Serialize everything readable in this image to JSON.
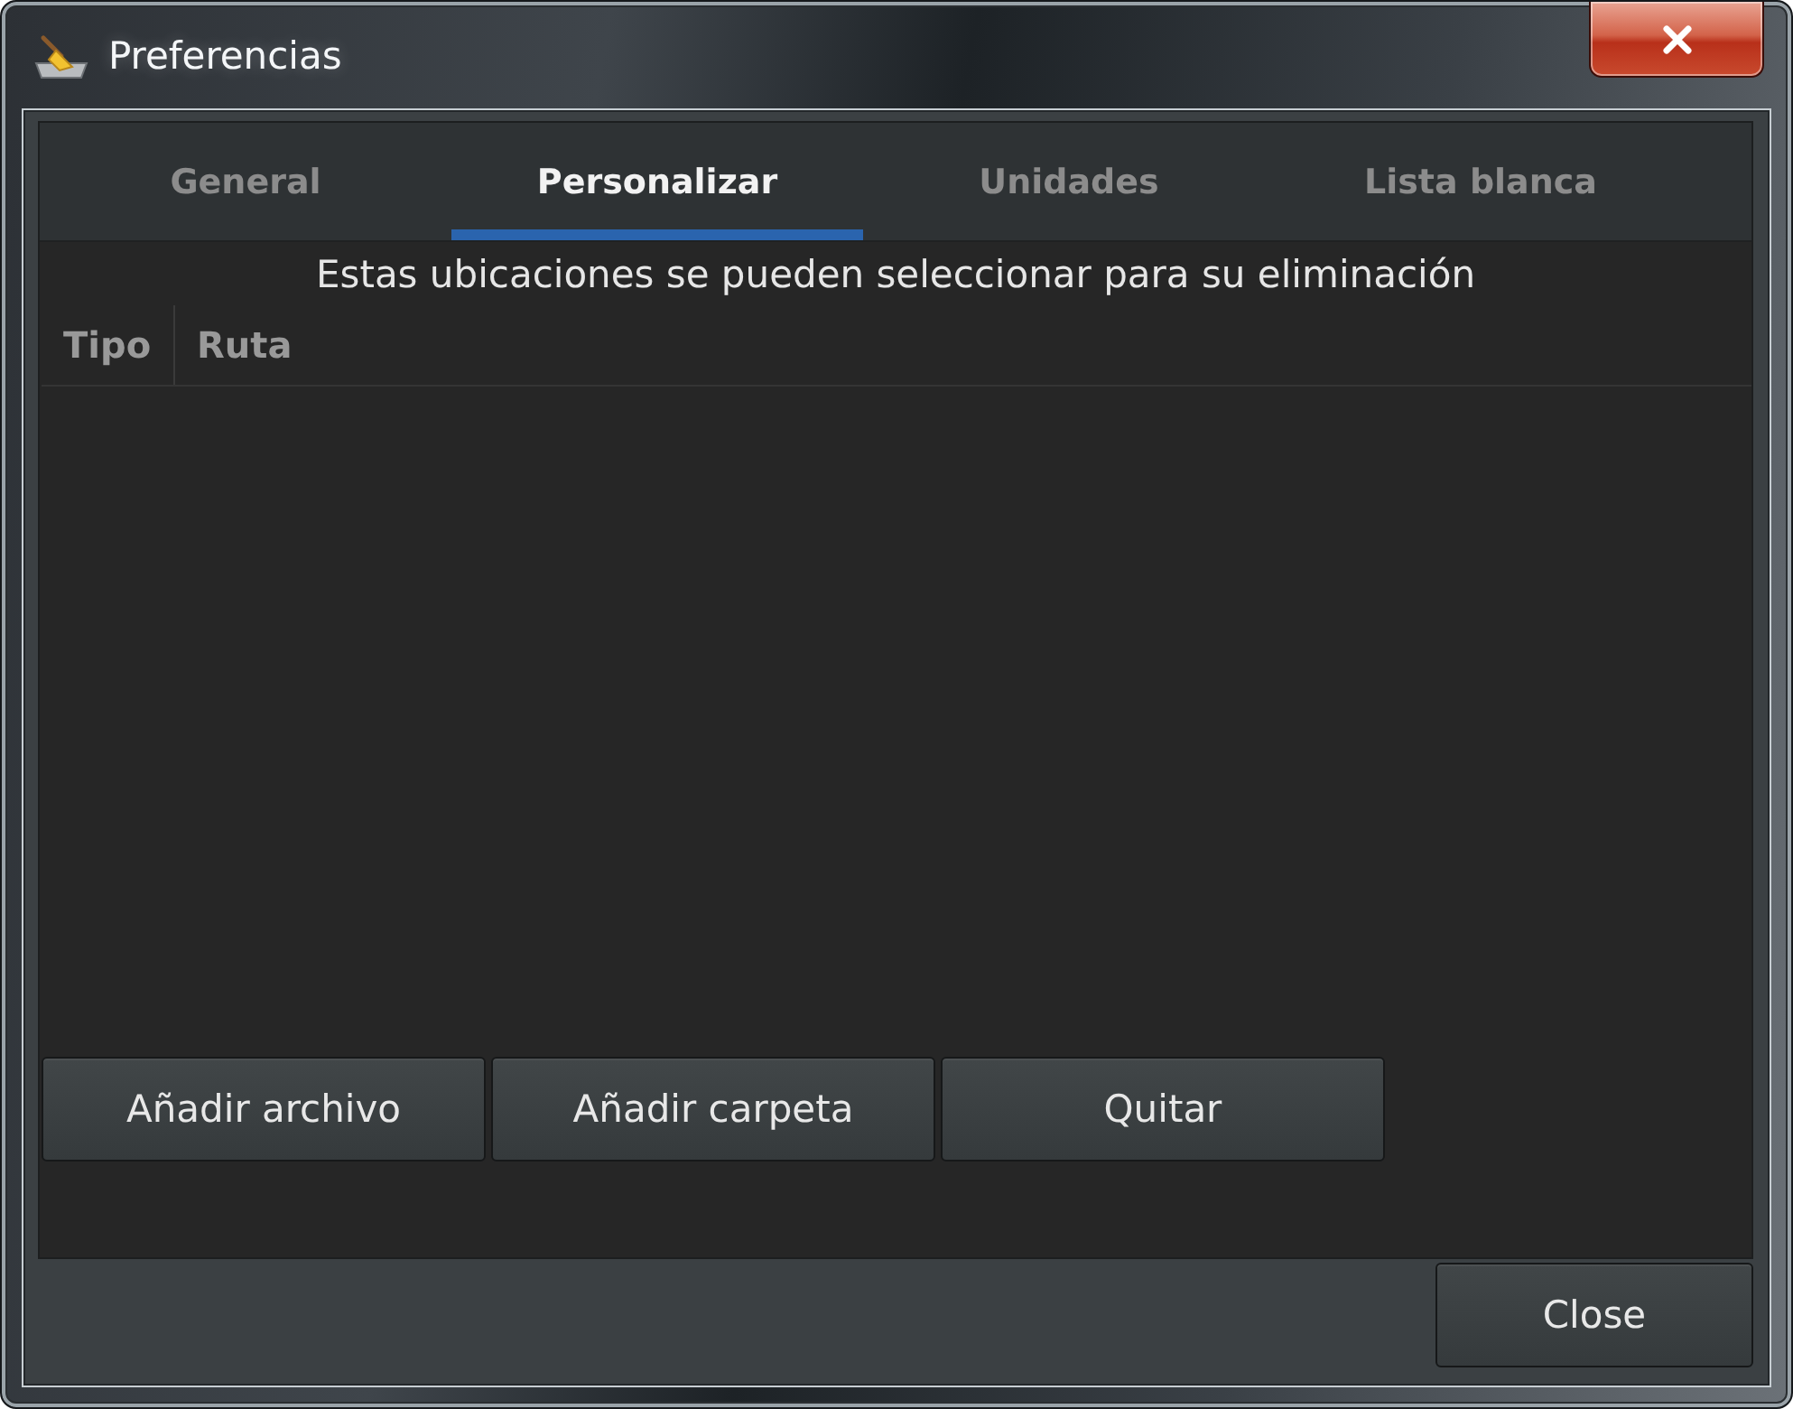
{
  "window": {
    "title": "Preferencias"
  },
  "tabs": [
    {
      "label": "General",
      "selected": false
    },
    {
      "label": "Personalizar",
      "selected": true
    },
    {
      "label": "Unidades",
      "selected": false
    },
    {
      "label": "Lista blanca",
      "selected": false
    }
  ],
  "description": "Estas ubicaciones se pueden seleccionar para su eliminación",
  "table": {
    "columns": [
      "Tipo",
      "Ruta"
    ]
  },
  "buttons": [
    "Añadir archivo",
    "Añadir carpeta",
    "Quitar"
  ],
  "footer_buttons": [
    "Close"
  ]
}
